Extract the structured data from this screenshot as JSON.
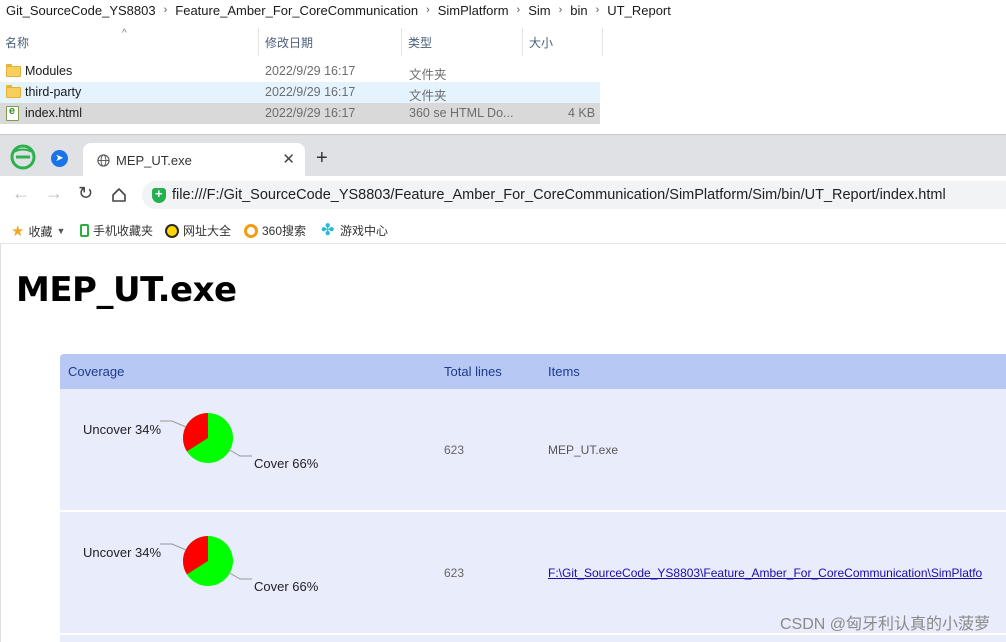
{
  "explorer": {
    "breadcrumb": [
      "Git_SourceCode_YS8803",
      "Feature_Amber_For_CoreCommunication",
      "SimPlatform",
      "Sim",
      "bin",
      "UT_Report"
    ],
    "columns": {
      "name": "名称",
      "date": "修改日期",
      "type": "类型",
      "size": "大小"
    },
    "files": [
      {
        "name": "Modules",
        "date": "2022/9/29 16:17",
        "type": "文件夹",
        "size": "",
        "icon": "folder-icon"
      },
      {
        "name": "third-party",
        "date": "2022/9/29 16:17",
        "type": "文件夹",
        "size": "",
        "icon": "folder-icon"
      },
      {
        "name": "index.html",
        "date": "2022/9/29 16:17",
        "type": "360 se HTML Do...",
        "size": "4 KB",
        "icon": "html-file-icon"
      }
    ]
  },
  "browser": {
    "tab_title": "MEP_UT.exe",
    "url": "file:///F:/Git_SourceCode_YS8803/Feature_Amber_For_CoreCommunication/SimPlatform/Sim/bin/UT_Report/index.html",
    "bookmarks": {
      "favorites": "收藏",
      "mobile": "手机收藏夹",
      "sites": "网址大全",
      "search": "360搜索",
      "games": "游戏中心"
    }
  },
  "report": {
    "page_title": "MEP_UT.exe",
    "headers": {
      "coverage": "Coverage",
      "total_lines": "Total lines",
      "items": "Items"
    },
    "rows": [
      {
        "uncover_label": "Uncover 34%",
        "cover_label": "Cover 66%",
        "uncover_pct": 34,
        "cover_pct": 66,
        "total_lines": "623",
        "item": "MEP_UT.exe"
      },
      {
        "uncover_label": "Uncover 34%",
        "cover_label": "Cover 66%",
        "uncover_pct": 34,
        "cover_pct": 66,
        "total_lines": "623",
        "item": "F:\\Git_SourceCode_YS8803\\Feature_Amber_For_CoreCommunication\\SimPlatfo"
      }
    ],
    "colors": {
      "cover": "#00ff00",
      "uncover": "#ff0000"
    }
  },
  "watermark": "CSDN @匈牙利认真的小菠萝"
}
